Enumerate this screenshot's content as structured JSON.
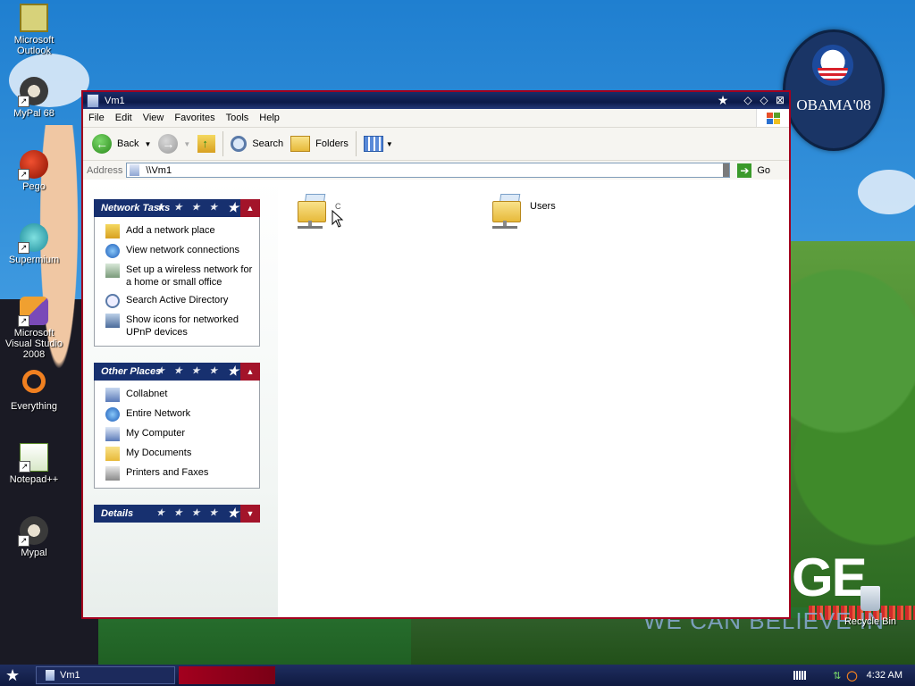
{
  "desktop": {
    "icons": [
      {
        "label": "Microsoft Outlook"
      },
      {
        "label": "MyPal 68"
      },
      {
        "label": "Pego"
      },
      {
        "label": "Supermium"
      },
      {
        "label": "Microsoft Visual Studio 2008"
      },
      {
        "label": "Everything"
      },
      {
        "label": "Notepad++"
      },
      {
        "label": "Mypal"
      }
    ],
    "recycle_bin": "Recycle Bin",
    "badge_text": "OBAMA'08",
    "wallpaper_text_1": "GE",
    "wallpaper_text_2": "WE CAN BELIEVE IN"
  },
  "window": {
    "title": "Vm1",
    "menu": [
      "File",
      "Edit",
      "View",
      "Favorites",
      "Tools",
      "Help"
    ],
    "toolbar": {
      "back": "Back",
      "search": "Search",
      "folders": "Folders"
    },
    "address": {
      "label": "Address",
      "value": "\\\\Vm1",
      "go": "Go"
    },
    "task_pane": {
      "network_tasks": {
        "title": "Network Tasks",
        "items": [
          "Add a network place",
          "View network connections",
          "Set up a wireless network for a home or small office",
          "Search Active Directory",
          "Show icons for networked UPnP devices"
        ]
      },
      "other_places": {
        "title": "Other Places",
        "items": [
          "Collabnet",
          "Entire Network",
          "My Computer",
          "My Documents",
          "Printers and Faxes"
        ]
      },
      "details": {
        "title": "Details"
      }
    },
    "shares": [
      {
        "name": "C"
      },
      {
        "name": "Users"
      }
    ]
  },
  "taskbar": {
    "task": "Vm1",
    "clock": "4:32 AM"
  },
  "colors": {
    "title_bar": "#0c1a48",
    "window_border": "#a3001e",
    "panel_header": "#17306f",
    "panel_arrow": "#a3142a"
  }
}
